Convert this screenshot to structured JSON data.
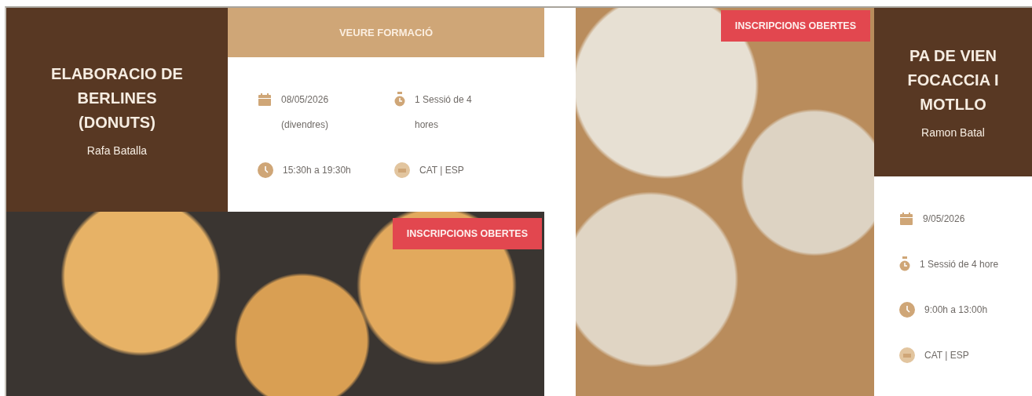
{
  "cards": [
    {
      "kind": "info-first",
      "title_lines": [
        "ELABORACIO DE",
        "BERLINES",
        "(DONUTS)"
      ],
      "teacher": "Rafa Batalla",
      "button": "VEURE FORMACIÓ",
      "details": [
        {
          "kind": "date",
          "lines": [
            "08/05/2026",
            "(divendres)"
          ]
        },
        {
          "kind": "sessions",
          "lines": [
            "1 Sessió de 4",
            "hores"
          ]
        },
        {
          "kind": "time",
          "lines": [
            "15:30h a 19:30h"
          ]
        },
        {
          "kind": "language",
          "lines": [
            "CAT | ESP"
          ]
        }
      ],
      "badge": "INSCRIPCIONS OBERTES"
    },
    {
      "kind": "photo-first",
      "title_lines": [
        "PA DE VIEN",
        "FOCACCIA I",
        "MOTLLO"
      ],
      "teacher": "Ramon Batal",
      "details": [
        {
          "kind": "date",
          "lines": [
            "9/05/2026"
          ]
        },
        {
          "kind": "sessions",
          "lines": [
            "1 Sessió de 4 hore"
          ]
        },
        {
          "kind": "time",
          "lines": [
            "9:00h a 13:00h"
          ]
        },
        {
          "kind": "language",
          "lines": [
            "CAT | ESP"
          ]
        }
      ],
      "badge": "INSCRIPCIONS OBERTES"
    }
  ]
}
